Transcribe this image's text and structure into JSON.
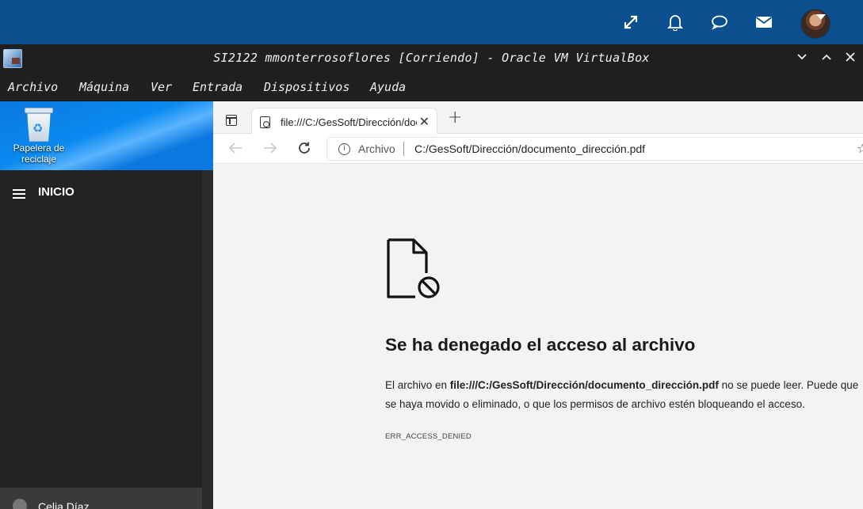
{
  "host": {
    "icons": [
      "expand-icon",
      "bell-icon",
      "chat-icon",
      "mail-icon"
    ]
  },
  "vbox": {
    "title": "SI2122 mmonterrosoflores [Corriendo] - Oracle VM VirtualBox",
    "menu": [
      "Archivo",
      "Máquina",
      "Ver",
      "Entrada",
      "Dispositivos",
      "Ayuda"
    ]
  },
  "desktop": {
    "recycle_label": "Papelera de reciclaje"
  },
  "start": {
    "title": "INICIO",
    "user": "Celia Díaz"
  },
  "browser": {
    "tab_label": "file:///C:/GesSoft/Dirección/documento_dirección.pdf",
    "address_scheme": "Archivo",
    "address_url": "C:/GesSoft/Dirección/documento_dirección.pdf",
    "error": {
      "title": "Se ha denegado el acceso al archivo",
      "body_prefix": "El archivo en ",
      "body_path": "file:///C:/GesSoft/Dirección/documento_dirección.pdf",
      "body_suffix": " no se puede leer. Puede que se haya movido o eliminado, o que los permisos de archivo estén bloqueando el acceso.",
      "code": "ERR_ACCESS_DENIED"
    }
  },
  "colors": {
    "host_bar": "#0b4f8f",
    "vbox_bar": "#1f1f1f",
    "start_menu": "#232323",
    "browser_bg": "#f3f3f3"
  }
}
